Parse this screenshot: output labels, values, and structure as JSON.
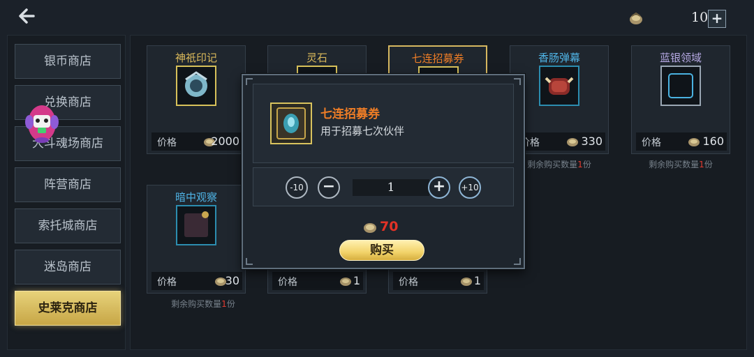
{
  "header": {
    "back_icon": "back-arrow-icon",
    "currency_icon": "coin-pouch-icon",
    "currency_amount": "10",
    "add_symbol": "+"
  },
  "sidebar": {
    "items": [
      {
        "label": "银币商店",
        "active": false
      },
      {
        "label": "兑换商店",
        "active": false
      },
      {
        "label": "大斗魂场商店",
        "active": false
      },
      {
        "label": "阵营商店",
        "active": false
      },
      {
        "label": "索托城商店",
        "active": false
      },
      {
        "label": "迷岛商店",
        "active": false
      },
      {
        "label": "史莱克商店",
        "active": true
      }
    ]
  },
  "shop": {
    "price_label": "价格",
    "remain_prefix": "剩余购买数量",
    "remain_suffix": "份",
    "items": [
      {
        "name": "神祇印记",
        "price": "2000",
        "name_color": "#d9b85a"
      },
      {
        "name": "灵石",
        "price": "",
        "name_color": "#d9b85a"
      },
      {
        "name": "七连招募券",
        "price": "",
        "name_color": "#ee7d26"
      },
      {
        "name": "香肠弹幕",
        "price": "330",
        "name_color": "#4fb4e6",
        "remaining": "1"
      },
      {
        "name": "蓝银领域",
        "price": "160",
        "name_color": "#b6a9e4",
        "remaining": "1"
      },
      {
        "name": "暗中观察",
        "price": "30",
        "name_color": "#4fb4e6",
        "remaining": "1"
      },
      {
        "name": "",
        "price": "1"
      },
      {
        "name": "",
        "price": "1"
      }
    ]
  },
  "modal": {
    "item_name": "七连招募券",
    "item_desc": "用于招募七次伙伴",
    "minus10": "-10",
    "minus": "−",
    "quantity": "1",
    "plus": "+",
    "plus10": "+10",
    "total": "70",
    "buy_label": "购买"
  },
  "colors": {
    "accent_gold": "#d7b860",
    "price_red": "#e23226"
  }
}
